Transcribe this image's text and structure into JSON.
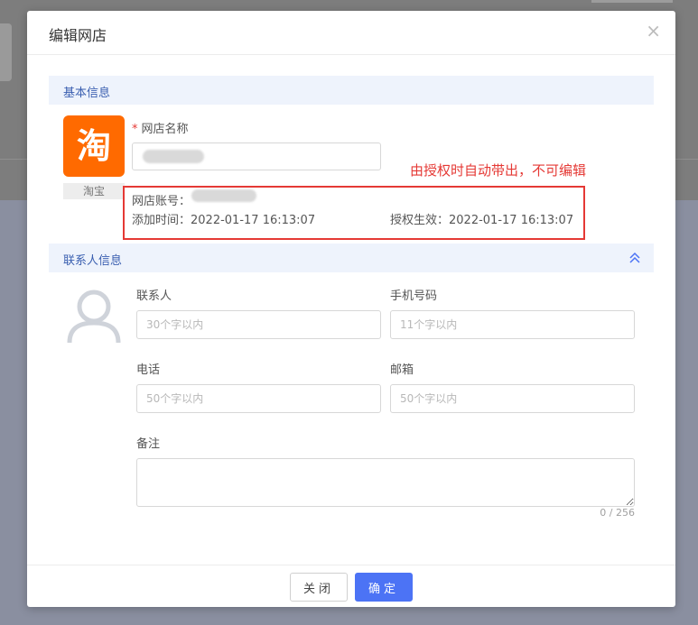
{
  "dialog": {
    "title": "编辑网店",
    "close_glyph": "×"
  },
  "basic_section": {
    "title": "基本信息"
  },
  "shop": {
    "platform_label": "淘宝",
    "logo_glyph": "淘",
    "name_label": "网店名称",
    "required_mark": "*"
  },
  "annotation": "由授权时自动带出，不可编辑",
  "auto_info": {
    "account_label": "网店账号：",
    "added_label": "添加时间：",
    "added_value": "2022-01-17 16:13:07",
    "auth_label": "授权生效：",
    "auth_value": "2022-01-17 16:13:07"
  },
  "contact_section": {
    "title": "联系人信息"
  },
  "contact": {
    "contact_label": "联系人",
    "contact_placeholder": "30个字以内",
    "mobile_label": "手机号码",
    "mobile_placeholder": "11个字以内",
    "phone_label": "电话",
    "phone_placeholder": "50个字以内",
    "email_label": "邮箱",
    "email_placeholder": "50个字以内",
    "remark_label": "备注",
    "remark_counter": "0 / 256"
  },
  "footer": {
    "close_label": "关闭",
    "ok_label": "确定"
  },
  "colors": {
    "primary": "#4c73f5",
    "brand_orange": "#ff6a00",
    "annotation_red": "#e53935",
    "section_bg": "#eef3fc"
  },
  "icons": [
    "close-icon",
    "taobao-logo",
    "chevron-double-up-icon",
    "user-avatar-icon"
  ]
}
